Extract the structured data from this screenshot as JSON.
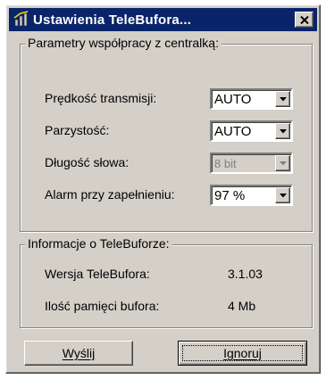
{
  "window": {
    "title": "Ustawienia TeleBufora...",
    "title_bar_color": "#0a246a"
  },
  "icons": {
    "app": "telebufor-app-icon",
    "close": "close-icon",
    "dropdown": "dropdown-arrow-icon"
  },
  "groups": {
    "params": {
      "legend": "Parametry współpracy z centralką:",
      "rows": [
        {
          "label": "Prędkość transmisji:",
          "value": "AUTO",
          "enabled": true
        },
        {
          "label": "Parzystość:",
          "value": "AUTO",
          "enabled": true
        },
        {
          "label": "Długość słowa:",
          "value": "8 bit",
          "enabled": false
        },
        {
          "label": "Alarm przy zapełnieniu:",
          "value": "97 %",
          "enabled": true
        }
      ]
    },
    "info": {
      "legend": "Informacje o TeleBuforze:",
      "rows": [
        {
          "label": "Wersja TeleBufora:",
          "value": "3.1.03"
        },
        {
          "label": "Ilość pamięci bufora:",
          "value": "4 Mb"
        }
      ]
    }
  },
  "buttons": {
    "send": "Wyślij",
    "ignore": "Ignoruj"
  }
}
